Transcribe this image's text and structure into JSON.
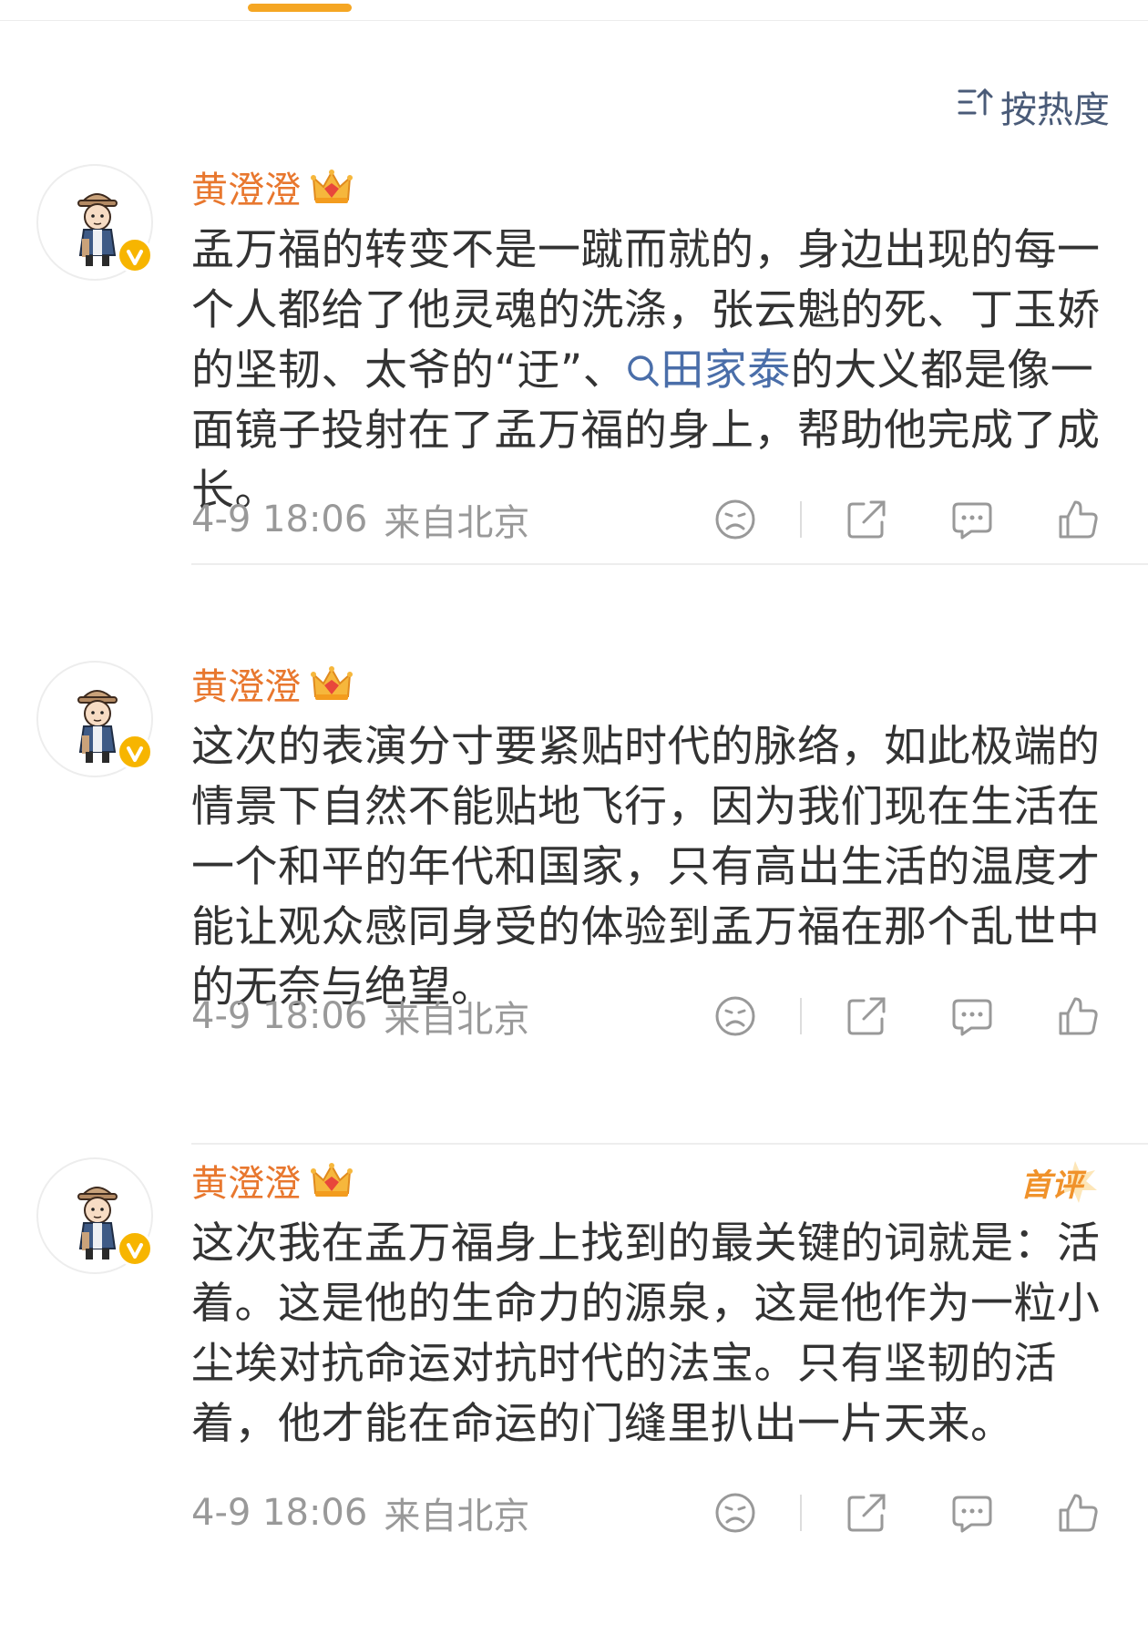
{
  "sort": {
    "label": "按热度"
  },
  "comments": [
    {
      "username": "黄澄澄",
      "text_before_link": "孟万福的转变不是一蹴而就的，身边出现的每一个人都给了他灵魂的洗涤，张云魁的死、丁玉娇的坚韧、太爷的“迂”、",
      "link": "田家泰",
      "text_after_link": "的大义都是像一面镜子投射在了孟万福的身上，帮助他完成了成长。",
      "date": "4-9 18:06",
      "source": "来自北京",
      "first_badge": ""
    },
    {
      "username": "黄澄澄",
      "text": "这次的表演分寸要紧贴时代的脉络，如此极端的情景下自然不能贴地飞行，因为我们现在生活在一个和平的年代和国家，只有高出生活的温度才能让观众感同身受的体验到孟万福在那个乱世中的无奈与绝望。",
      "date": "4-9 18:06",
      "source": "来自北京",
      "first_badge": ""
    },
    {
      "username": "黄澄澄",
      "text": "这次我在孟万福身上找到的最关键的词就是：活着。这是他的生命力的源泉，这是他作为一粒小尘埃对抗命运对抗时代的法宝。只有坚韧的活着，他才能在命运的门缝里扒出一片天来。",
      "date": "4-9 18:06",
      "source": "来自北京",
      "first_badge": "首评"
    }
  ],
  "icons": {
    "sort": "sort-icon",
    "dislike": "dislike-face-icon",
    "share": "share-icon",
    "comment": "comment-icon",
    "like": "thumbs-up-icon",
    "crown": "crown-badge-icon",
    "verified": "verified-v-icon",
    "search": "search-icon"
  },
  "colors": {
    "accent": "#f5a623",
    "username": "#e8772e",
    "link": "#4a6ea9",
    "meta": "#999999"
  }
}
